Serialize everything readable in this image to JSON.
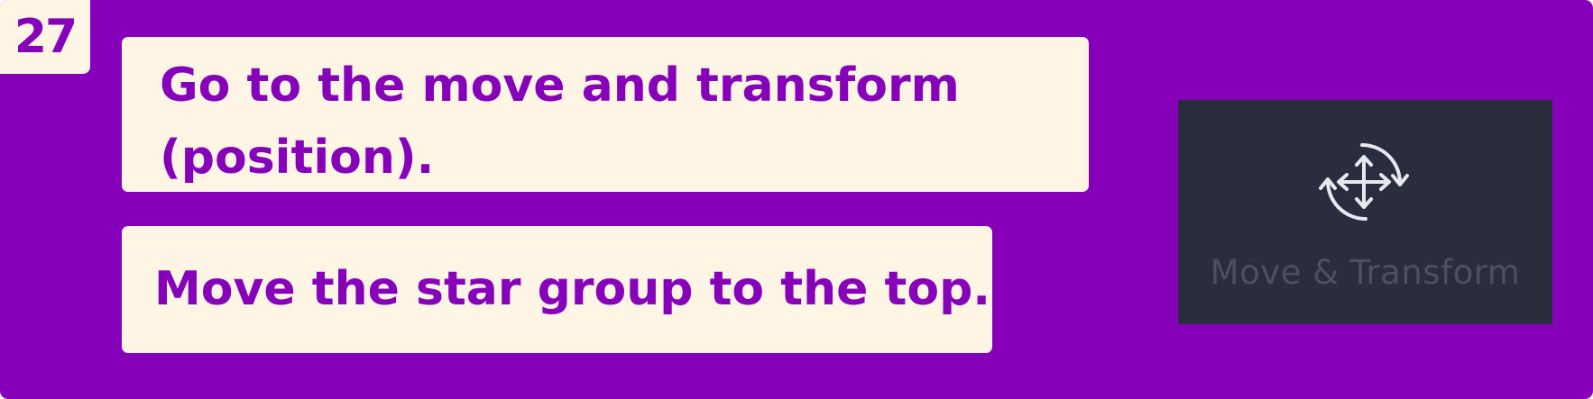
{
  "step": {
    "number": "27"
  },
  "instructions": [
    {
      "text": "Go to the move and transform (position)."
    },
    {
      "text": "Move the star group to the top."
    }
  ],
  "tool_preview": {
    "icon": "move-transform-icon",
    "label": "Move & Transform"
  },
  "colors": {
    "background": "#8700b9",
    "card": "#fff5e4",
    "text": "#8700b9",
    "thumbnail_bg": "#292d3e",
    "icon": "#e8e9ee",
    "thumbnail_label": "#4c5060"
  }
}
